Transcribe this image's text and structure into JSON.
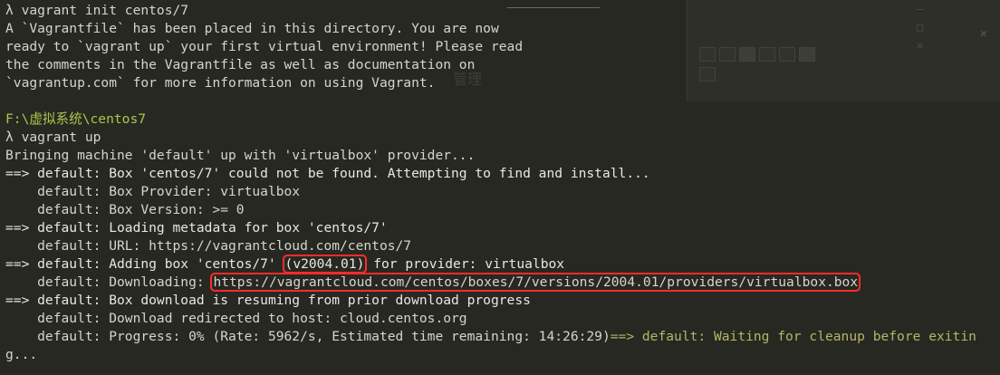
{
  "terminal": {
    "lines": [
      {
        "kind": "prompt-cmd",
        "text": "λ vagrant init centos/7"
      },
      {
        "kind": "out",
        "text": "A `Vagrantfile` has been placed in this directory. You are now"
      },
      {
        "kind": "out",
        "text": "ready to `vagrant up` your first virtual environment! Please read"
      },
      {
        "kind": "out",
        "text": "the comments in the Vagrantfile as well as documentation on"
      },
      {
        "kind": "out",
        "text": "`vagrantup.com` for more information on using Vagrant."
      },
      {
        "kind": "blank",
        "text": ""
      },
      {
        "kind": "prompt-path",
        "text": "F:\\虚拟系统\\centos7"
      },
      {
        "kind": "prompt-cmd",
        "text": "λ vagrant up"
      },
      {
        "kind": "out",
        "text": "Bringing machine 'default' up with 'virtualbox' provider..."
      },
      {
        "kind": "arrow",
        "text": "==> default: Box 'centos/7' could not be found. Attempting to find and install..."
      },
      {
        "kind": "out",
        "text": "    default: Box Provider: virtualbox"
      },
      {
        "kind": "out",
        "text": "    default: Box Version: >= 0"
      },
      {
        "kind": "arrow",
        "text": "==> default: Loading metadata for box 'centos/7'"
      },
      {
        "kind": "out",
        "text": "    default: URL: https://vagrantcloud.com/centos/7"
      }
    ],
    "adding_box": {
      "prefix": "==> default: Adding box 'centos/7' ",
      "version": "(v2004.01)",
      "suffix": " for provider: virtualbox"
    },
    "downloading": {
      "prefix": "    default: Downloading: ",
      "url": "https://vagrantcloud.com/centos/boxes/7/versions/2004.01/providers/virtualbox.box"
    },
    "lines_after": [
      {
        "kind": "arrow",
        "text": "==> default: Box download is resuming from prior download progress"
      },
      {
        "kind": "out",
        "text": "    default: Download redirected to host: cloud.centos.org"
      }
    ],
    "progress": {
      "main": "    default: Progress: 0% (Rate: 5962/s, Estimated time remaining: 14:26:29)",
      "waiting": "==> default: Waiting for cleanup before exitin",
      "wrap": "g..."
    }
  },
  "colors": {
    "background": "#272822",
    "text": "#d5d5cc",
    "path": "#a6c94a",
    "highlight_box": "#ff2b2b"
  }
}
